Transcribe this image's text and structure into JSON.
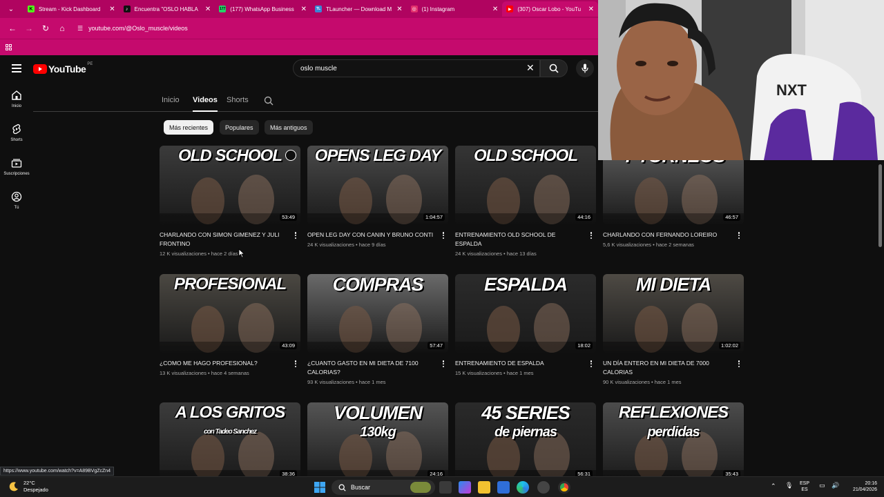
{
  "browser": {
    "tabs": [
      {
        "title": "Stream - Kick Dashboard",
        "favicon_color": "#53fc18",
        "favicon_text": "K"
      },
      {
        "title": "Encuentra \"OSLO HABLA",
        "favicon_color": "#000000",
        "favicon_text": "♪"
      },
      {
        "title": "(177) WhatsApp Business",
        "favicon_color": "#25d366",
        "favicon_text": "177"
      },
      {
        "title": "TLauncher — Download M",
        "favicon_color": "#3a86d4",
        "favicon_text": "TL"
      },
      {
        "title": "(1) Instagram",
        "favicon_color": "#e1306c",
        "favicon_text": "◎"
      },
      {
        "title": "(307) Oscar Lobo - YouTu",
        "favicon_color": "#ff0000",
        "favicon_text": "▶"
      }
    ],
    "url": "youtube.com/@Oslo_muscle/videos",
    "status_link": "https://www.youtube.com/watch?v=A89BVgZcZn4"
  },
  "youtube": {
    "logo_text": "YouTube",
    "country_code": "PE",
    "search_query": "oslo muscle",
    "rail": [
      {
        "label": "Inicio",
        "icon": "home-icon"
      },
      {
        "label": "Shorts",
        "icon": "shorts-icon"
      },
      {
        "label": "Suscripciones",
        "icon": "subscriptions-icon"
      },
      {
        "label": "Tú",
        "icon": "you-icon"
      }
    ],
    "channel_tabs": [
      "Inicio",
      "Videos",
      "Shorts"
    ],
    "chips": [
      "Más recientes",
      "Populares",
      "Más antiguos"
    ],
    "videos": [
      {
        "thumb_text": "OLD SCHOOL",
        "duration": "53:49",
        "title": "CHARLANDO CON SIMON GIMENEZ Y JULI FRONTINO",
        "meta": "12 K visualizaciones • hace 2 días",
        "bg": "#3b3b3b"
      },
      {
        "thumb_text": "OPENS LEG DAY",
        "duration": "1:04:57",
        "title": "OPEN LEG DAY con CANIN y BRUNO CONTI",
        "meta": "24 K visualizaciones • hace 9 días",
        "bg": "#4a4a4a"
      },
      {
        "thumb_text": "OLD SCHOOL",
        "duration": "44:16",
        "title": "ENTRENAMIENTO OLD SCHOOL DE ESPALDA",
        "meta": "24 K visualizaciones • hace 13 días",
        "bg": "#353535"
      },
      {
        "thumb_text": "Y TORNEOS",
        "duration": "46:57",
        "title": "CHARLANDO CON FERNANDO LOREIRO",
        "meta": "5,6 K visualizaciones • hace 2 semanas",
        "bg": "#5a5a5a"
      },
      {
        "thumb_text": "PROFESIONAL",
        "duration": "43:09",
        "title": "¿COMO ME HAGO PROFESIONAL?",
        "meta": "13 K visualizaciones • hace 4 semanas",
        "bg": "#4b4842"
      },
      {
        "thumb_text": "COMPRAS",
        "duration": "57:47",
        "title": "¿CUANTO GASTO EN MI DIETA DE 7100 CALORIAS?",
        "meta": "93 K visualizaciones • hace 1 mes",
        "bg": "#6a6a6a"
      },
      {
        "thumb_text": "ESPALDA",
        "duration": "18:02",
        "title": "ENTRENAMIENTO DE ESPALDA",
        "meta": "15 K visualizaciones • hace 1 mes",
        "bg": "#2b2b2b"
      },
      {
        "thumb_text": "MI DIETA",
        "duration": "1:02:02",
        "title": "UN DÍA ENTERO EN MI DIETA DE 7000 CALORIAS",
        "meta": "90 K visualizaciones • hace 1 mes",
        "bg": "#4e4a44"
      },
      {
        "thumb_text": "A LOS GRITOS",
        "duration": "38:36",
        "title": "",
        "meta": "",
        "bg": "#3c3c3c"
      },
      {
        "thumb_text": "VOLUMEN",
        "duration": "24:16",
        "title": "",
        "meta": "",
        "bg": "#555555"
      },
      {
        "thumb_text": "45 SERIES",
        "duration": "56:31",
        "title": "",
        "meta": "",
        "bg": "#2a2a2a"
      },
      {
        "thumb_text": "REFLEXIONES",
        "duration": "35:43",
        "title": "",
        "meta": "",
        "bg": "#4c4c4c"
      }
    ],
    "thumb_subs": {
      "v8": "con Tadeo Sanchez",
      "v9": "130kg",
      "v10": "de piernas",
      "v11": "perdidas"
    }
  },
  "taskbar": {
    "weather_temp": "22°C",
    "weather_desc": "Despejado",
    "search_placeholder": "Buscar",
    "lang_top": "ESP",
    "lang_bottom": "ES",
    "time": "20:16",
    "date": "21/04/2026"
  },
  "colors": {
    "browser_accent": "#c50a6d",
    "yt_red": "#ff0000",
    "yt_bg": "#0f0f0f"
  }
}
